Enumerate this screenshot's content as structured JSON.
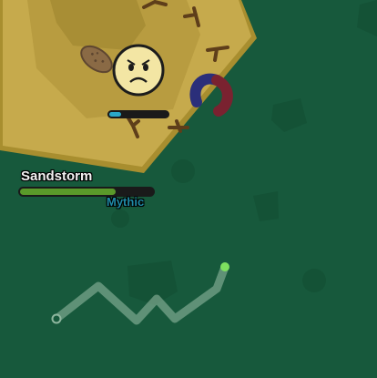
{
  "mob": {
    "name": "Sandstorm",
    "rarity": "Mythic",
    "health_fraction": 0.72
  },
  "player": {
    "health_fraction": 0.2,
    "face": "angry-face"
  },
  "colors": {
    "grass": "#17593c",
    "sand": "#c6aa4c",
    "rarity_mythic": "#1f8aa6",
    "mob_health": "#5a9a2a",
    "player_health": "#2aa7c7"
  },
  "icons": [
    "stick-petal-icon",
    "peanut-petal-icon",
    "magnet-petal-icon",
    "movement-trail"
  ]
}
